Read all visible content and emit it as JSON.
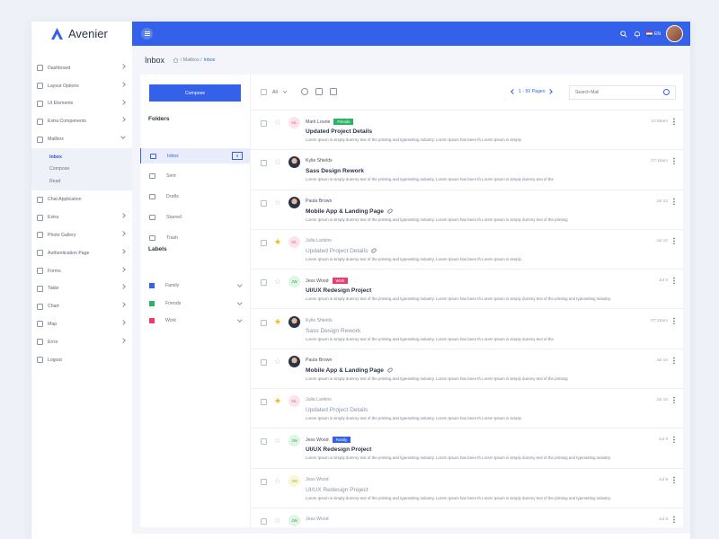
{
  "brand": {
    "name": "Avenier",
    "accent": "#3461e9"
  },
  "sidebar": {
    "items": [
      {
        "label": "Dashboard",
        "chevron": true
      },
      {
        "label": "Layout Options",
        "chevron": true
      },
      {
        "label": "UI Elements",
        "chevron": true
      },
      {
        "label": "Extra  Components",
        "chevron": true
      },
      {
        "label": "Mailbox",
        "chevron": true,
        "expanded": true
      }
    ],
    "mailbox_sub": [
      {
        "label": "Inbox",
        "active": true
      },
      {
        "label": "Compose"
      },
      {
        "label": "Read"
      }
    ],
    "items2": [
      {
        "label": "Chat Application",
        "chevron": false
      },
      {
        "label": "Extra",
        "chevron": true
      },
      {
        "label": "Photo Gallery",
        "chevron": true
      },
      {
        "label": "Authentication Page",
        "chevron": true
      },
      {
        "label": "Forms",
        "chevron": true
      },
      {
        "label": "Table",
        "chevron": true
      },
      {
        "label": "Chart",
        "chevron": true
      },
      {
        "label": "Map",
        "chevron": true
      },
      {
        "label": "Error",
        "chevron": true
      },
      {
        "label": "Logout",
        "chevron": false
      }
    ]
  },
  "topbar": {
    "lang": "EN"
  },
  "page": {
    "title": "Inbox",
    "crumb_mailbox": "/ Mailbox /",
    "crumb_current": "Inbox"
  },
  "mailnav": {
    "compose_label": "Compose",
    "folders_title": "Folders",
    "folders": [
      {
        "label": "Inbox",
        "count": "6",
        "active": true
      },
      {
        "label": "Sent"
      },
      {
        "label": "Drafts"
      },
      {
        "label": "Starred"
      },
      {
        "label": "Trash"
      }
    ],
    "labels_title": "Labels",
    "labels": [
      {
        "label": "Family",
        "color": "#3461e9"
      },
      {
        "label": "Friends",
        "color": "#28b463"
      },
      {
        "label": "Work",
        "color": "#e83e6c"
      }
    ]
  },
  "toolbar": {
    "all_label": "All",
    "pager_text": "1 - 50 Pages",
    "search_placeholder": "Search Mail"
  },
  "mails": [
    {
      "sender": "Mark Lourie",
      "initials": "ML",
      "avatar": "ml",
      "tag": "Friends",
      "tag_color": "#28b463",
      "subject": "Updated Project Details",
      "clip": false,
      "preview": "Lorem Ipsum is simply dummy text of the printing and typesetting industry. Lorem Ipsum has been th Lorem Ipsum is simply.",
      "time": "10:56am",
      "starred": false,
      "read": false
    },
    {
      "sender": "Kylie Shields",
      "initials": "",
      "avatar": "photo",
      "tag": "",
      "tag_color": "",
      "subject": "Sass Design Rework",
      "clip": false,
      "preview": "Lorem Ipsum is simply dummy text of the printing and typesetting industry. Lorem Ipsum has been th Lorem Ipsum is simply dummy text of the",
      "time": "07:15am",
      "starred": false,
      "read": false
    },
    {
      "sender": "Paula Brown",
      "initials": "",
      "avatar": "photo",
      "tag": "",
      "tag_color": "",
      "subject": "Mobile App & Landing Page",
      "clip": true,
      "preview": "Lorem Ipsum is simply dummy text of the printing and typesetting industry. Lorem Ipsum has been th Lorem Ipsum is simply dummy text of the printing",
      "time": "Jul 10",
      "starred": false,
      "read": false
    },
    {
      "sender": "Julia Larkins",
      "initials": "ML",
      "avatar": "ml",
      "tag": "",
      "tag_color": "",
      "subject": "Updated Project Details",
      "clip": true,
      "preview": "Lorem Ipsum is simply dummy text of the printing and typesetting industry. Lorem Ipsum has been th Lorem Ipsum is simply.",
      "time": "Jul 10",
      "starred": true,
      "read": true
    },
    {
      "sender": "Jess Wood",
      "initials": "JW",
      "avatar": "jw",
      "tag": "Work",
      "tag_color": "#e83e6c",
      "subject": "UI/UX Redesign Project",
      "clip": false,
      "preview": "Lorem Ipsum is simply dummy text of the printing and typesetting industry. Lorem Ipsum has been th Lorem Ipsum is simply dummy text of the printing and typesetting industry.",
      "time": "Jul 9",
      "starred": false,
      "read": false
    },
    {
      "sender": "Kylie Shields",
      "initials": "",
      "avatar": "photo",
      "tag": "",
      "tag_color": "",
      "subject": "Sass Design Rework",
      "clip": false,
      "preview": "Lorem Ipsum is simply dummy text of the printing and typesetting industry. Lorem Ipsum has been th Lorem Ipsum is simply dummy text of the",
      "time": "07:15am",
      "starred": true,
      "read": true
    },
    {
      "sender": "Paula Brown",
      "initials": "",
      "avatar": "photo",
      "tag": "",
      "tag_color": "",
      "subject": "Mobile App & Landing Page",
      "clip": true,
      "preview": "Lorem Ipsum is simply dummy text of the printing and typesetting industry. Lorem Ipsum has been th Lorem Ipsum is simply dummy text of the printing",
      "time": "Jul 10",
      "starred": false,
      "read": false
    },
    {
      "sender": "Julia Larkins",
      "initials": "ML",
      "avatar": "ml",
      "tag": "",
      "tag_color": "",
      "subject": "Updated Project Details",
      "clip": false,
      "preview": "Lorem Ipsum is simply dummy text of the printing and typesetting industry. Lorem Ipsum has been th Lorem Ipsum is simply.",
      "time": "Jul 10",
      "starred": true,
      "read": true
    },
    {
      "sender": "Jess Wood",
      "initials": "JW",
      "avatar": "jw",
      "tag": "Family",
      "tag_color": "#3461e9",
      "subject": "UI/UX Redesign Project",
      "clip": false,
      "preview": "Lorem Ipsum is simply dummy text of the printing and typesetting industry. Lorem Ipsum has been th Lorem Ipsum is simply dummy text of the printing and typesetting industry.",
      "time": "Jul 9",
      "starred": false,
      "read": false
    },
    {
      "sender": "Jess Wood",
      "initials": "JW",
      "avatar": "jwy",
      "tag": "",
      "tag_color": "",
      "subject": "UI/UX Redesign Project",
      "clip": false,
      "preview": "Lorem Ipsum is simply dummy text of the printing and typesetting industry. Lorem Ipsum has been th Lorem Ipsum is simply dummy text of the printing and typesetting industry.",
      "time": "Jul 9",
      "starred": false,
      "read": true
    },
    {
      "sender": "Jess Wood",
      "initials": "JW",
      "avatar": "jw",
      "tag": "",
      "tag_color": "",
      "subject": "",
      "clip": false,
      "preview": "",
      "time": "Jul 9",
      "starred": false,
      "read": true
    }
  ]
}
